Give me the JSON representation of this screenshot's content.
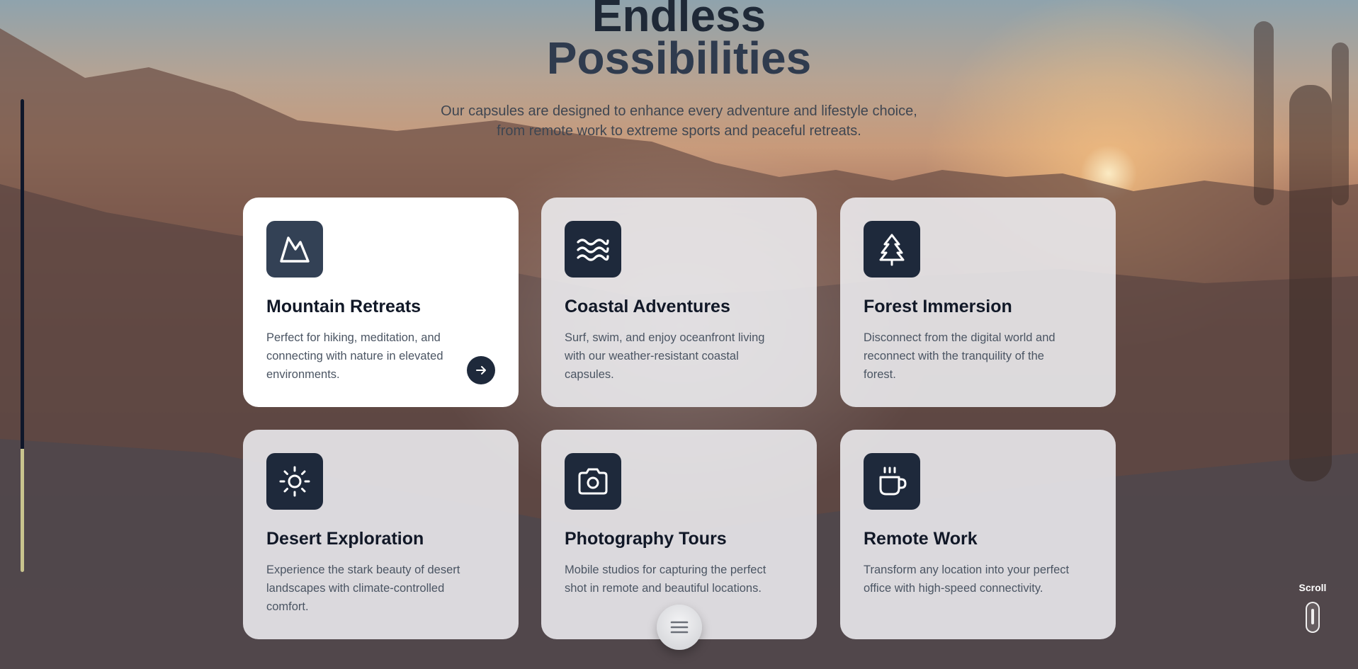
{
  "hero": {
    "title_line1": "Endless",
    "title_line2": "Possibilities",
    "subtitle_line1": "Our capsules are designed to enhance every adventure and lifestyle choice,",
    "subtitle_line2": "from remote work to extreme sports and peaceful retreats."
  },
  "progress": {
    "value_fraction": 0.74,
    "fill_color": "#0f172a",
    "track_color": "#c9c48e"
  },
  "cards": [
    {
      "icon": "mountain-icon",
      "title": "Mountain Retreats",
      "description": "Perfect for hiking, meditation, and connecting with nature in elevated environments.",
      "active": true
    },
    {
      "icon": "waves-icon",
      "title": "Coastal Adventures",
      "description": "Surf, swim, and enjoy oceanfront living with our weather-resistant coastal capsules."
    },
    {
      "icon": "tree-icon",
      "title": "Forest Immersion",
      "description": "Disconnect from the digital world and reconnect with the tranquility of the forest."
    },
    {
      "icon": "sun-icon",
      "title": "Desert Exploration",
      "description": "Experience the stark beauty of desert landscapes with climate-controlled comfort."
    },
    {
      "icon": "camera-icon",
      "title": "Photography Tours",
      "description": "Mobile studios for capturing the perfect shot in remote and beautiful locations."
    },
    {
      "icon": "coffee-icon",
      "title": "Remote Work",
      "description": "Transform any location into your perfect office with high-speed connectivity."
    }
  ],
  "scroll_indicator": {
    "label": "Scroll"
  },
  "colors": {
    "card_icon_bg": "#1e293b",
    "heading": "#1f2937",
    "accent_progress": "#c9c48e"
  }
}
